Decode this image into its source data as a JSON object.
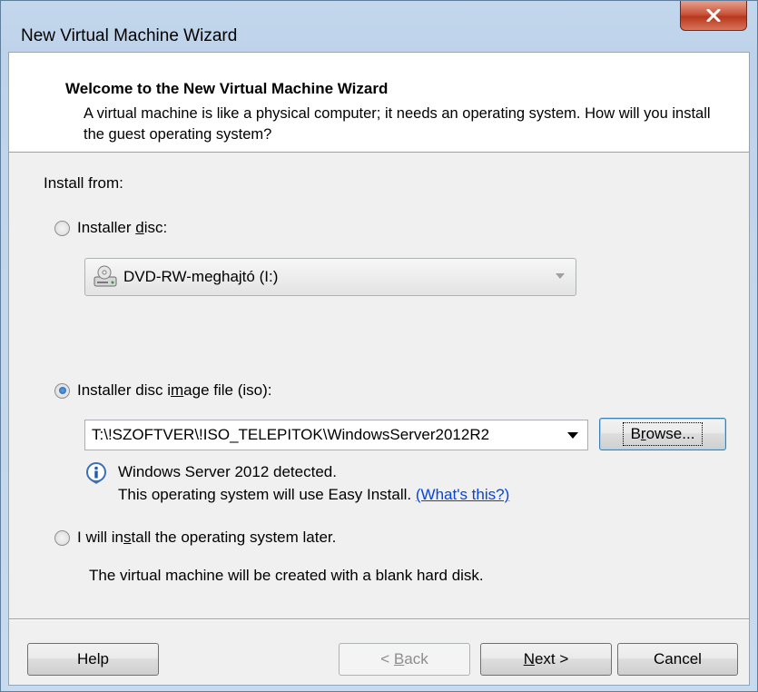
{
  "window": {
    "title": "New Virtual Machine Wizard"
  },
  "header": {
    "title": "Welcome to the New Virtual Machine Wizard",
    "description": "A virtual machine is like a physical computer; it needs an operating system. How will you install the guest operating system?"
  },
  "install": {
    "label": "Install from:",
    "options": [
      {
        "pre": "Installer ",
        "key": "d",
        "post": "isc:",
        "selected": false
      },
      {
        "pre": "Installer disc i",
        "key": "m",
        "post": "age file (iso):",
        "selected": true
      },
      {
        "pre": "I will in",
        "key": "s",
        "post": "tall the operating system later.",
        "selected": false
      }
    ],
    "disc_combo_value": "DVD-RW-meghajtó (I:)",
    "iso_combo_value": "T:\\!SZOFTVER\\!ISO_TELEPITOK\\WindowsServer2012R2",
    "browse_pre": "B",
    "browse_key": "r",
    "browse_post": "owse...",
    "detected_text": "Windows Server 2012 detected.",
    "easy_install_text": "This operating system will use Easy Install.",
    "whats_this_link": "(What's this?)",
    "later_description": "The virtual machine will be created with a blank hard disk."
  },
  "footer": {
    "help": "Help",
    "back_pre": "< ",
    "back_key": "B",
    "back_post": "ack",
    "next_pre": "",
    "next_key": "N",
    "next_post": "ext >",
    "cancel": "Cancel"
  },
  "colors": {
    "link": "#0645d8",
    "close_button": "#c9563c",
    "header_bg": "#ffffff",
    "dialog_bg": "#f0f0f0"
  },
  "icons": [
    "close-icon",
    "disc-drive-icon",
    "info-icon",
    "dropdown-arrow-icon"
  ]
}
